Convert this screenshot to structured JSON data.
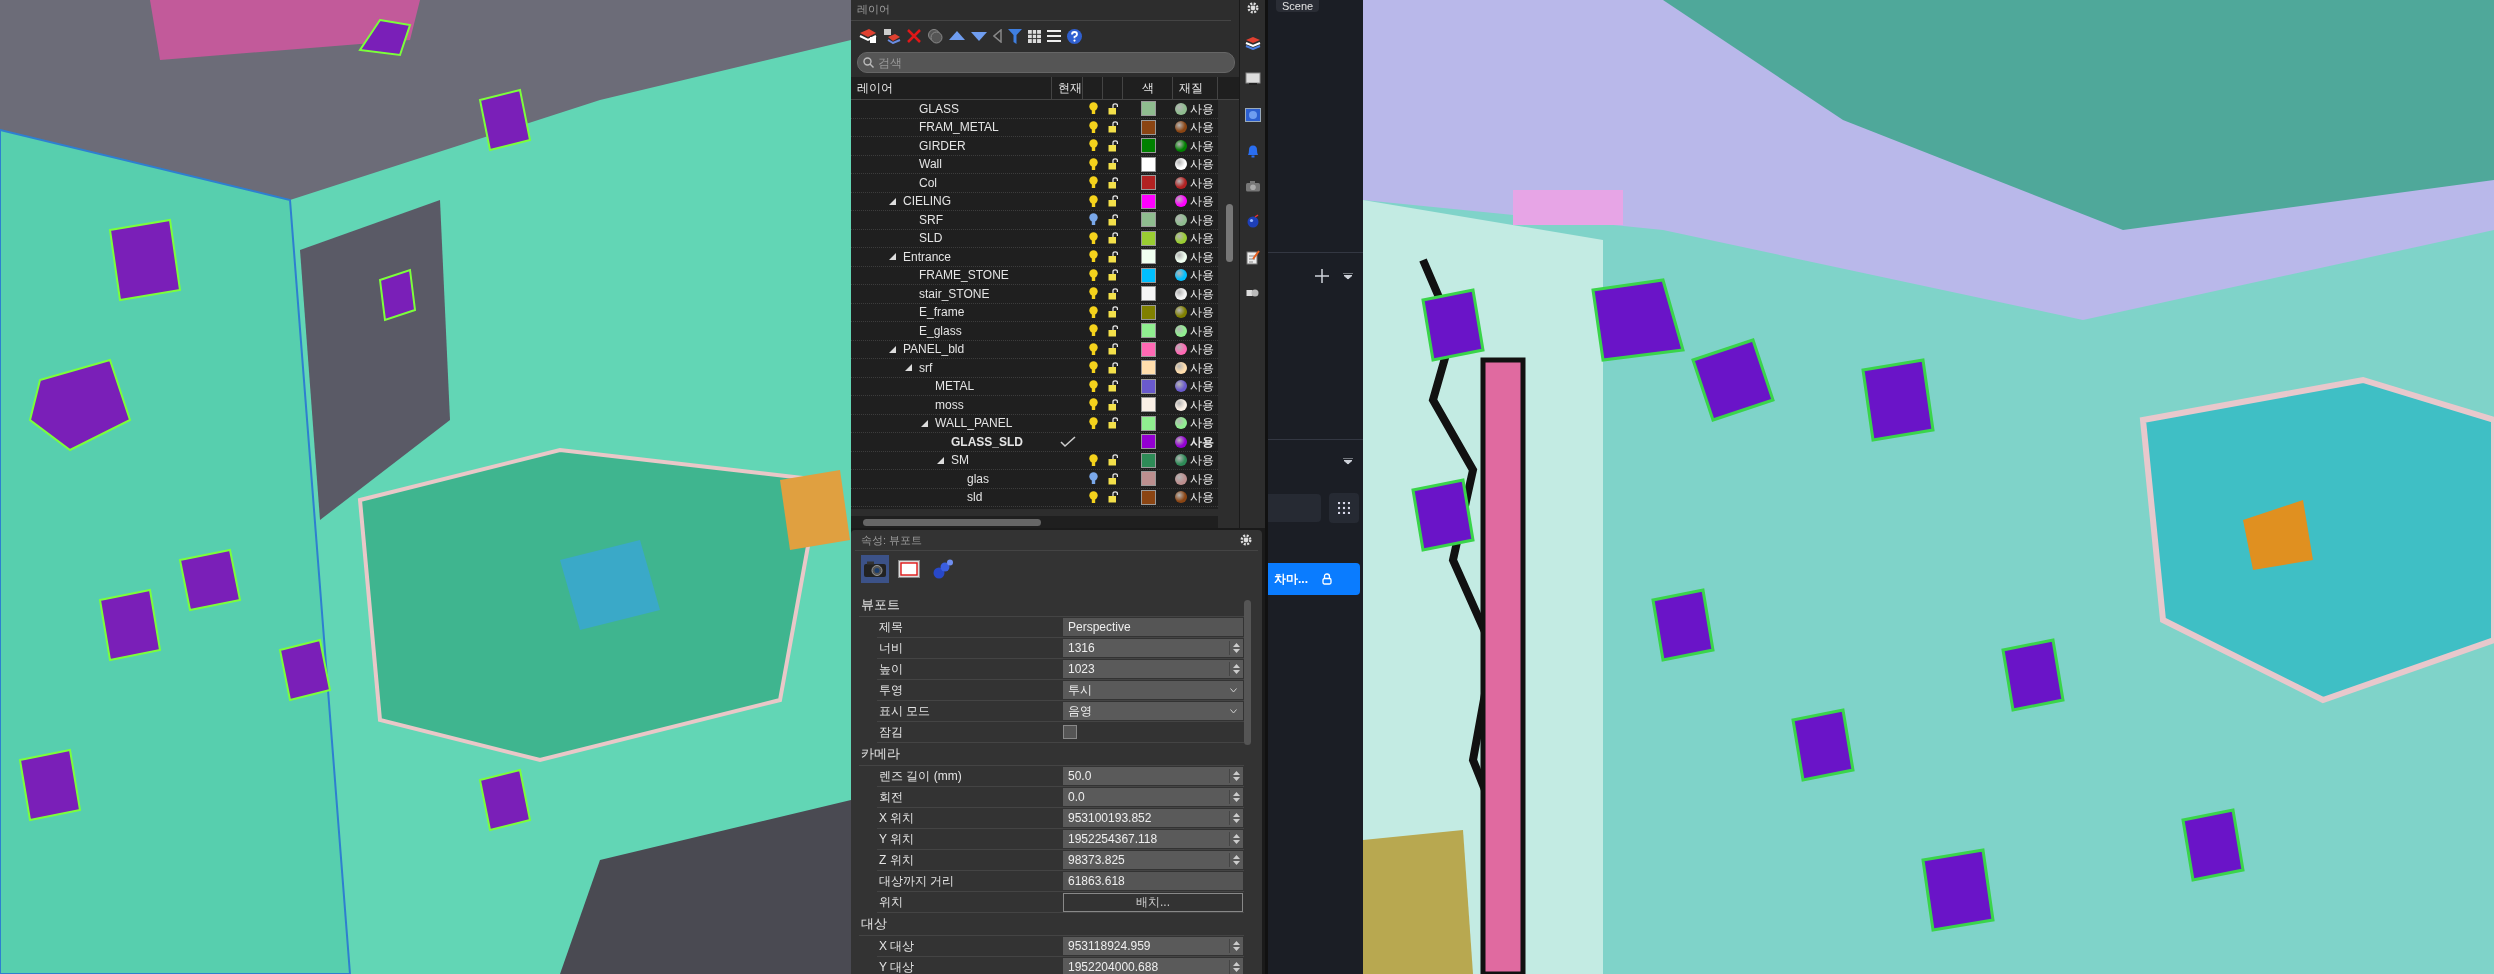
{
  "layers_panel": {
    "title": "레이어",
    "search": {
      "placeholder": "검색"
    },
    "columns": [
      "레이어",
      "현재",
      "색",
      "재질"
    ],
    "layers": [
      {
        "children": [
          {
            "name": "GLASS",
            "current": false,
            "on": true,
            "color": "#8fbc8f",
            "material": "사용"
          },
          {
            "name": "FRAM_METAL",
            "current": false,
            "on": true,
            "color": "#8b4513",
            "material": "사용"
          },
          {
            "name": "GIRDER",
            "current": false,
            "on": true,
            "color": "#008000",
            "material": "사용"
          },
          {
            "name": "Wall",
            "current": false,
            "on": true,
            "color": "#ffffff",
            "material": "사용"
          },
          {
            "name": "Col",
            "current": false,
            "on": true,
            "color": "#b22222",
            "material": "사용"
          }
        ]
      },
      {
        "name": "CIELING",
        "current": false,
        "expanded": true,
        "on": true,
        "color": "#ff00ff",
        "material": "사용",
        "children": [
          {
            "name": "SRF",
            "current": false,
            "on": false,
            "color": "#8fbc8f",
            "material": "사용"
          },
          {
            "name": "SLD",
            "current": false,
            "on": true,
            "color": "#9acd32",
            "material": "사용"
          }
        ]
      },
      {
        "name": "Entrance",
        "current": false,
        "expanded": true,
        "on": true,
        "color": "#f0fff0",
        "material": "사용",
        "children": [
          {
            "name": "FRAME_STONE",
            "current": false,
            "on": true,
            "color": "#00bfff",
            "material": "사용"
          },
          {
            "name": "stair_STONE",
            "current": false,
            "on": true,
            "color": "#f5f5f5",
            "material": "사용"
          },
          {
            "name": "E_frame",
            "current": false,
            "on": true,
            "color": "#808000",
            "material": "사용"
          },
          {
            "name": "E_glass",
            "current": false,
            "on": true,
            "color": "#90ee90",
            "material": "사용"
          }
        ]
      },
      {
        "name": "PANEL_bld",
        "current": false,
        "expanded": true,
        "on": true,
        "color": "#ff69b4",
        "material": "사용",
        "children": [
          {
            "name": "srf",
            "current": false,
            "expanded": true,
            "on": true,
            "color": "#ffdead",
            "material": "사용",
            "children": [
              {
                "name": "METAL",
                "current": false,
                "on": true,
                "color": "#6a5acd",
                "material": "사용"
              },
              {
                "name": "moss",
                "current": false,
                "on": true,
                "color": "#faf0e6",
                "material": "사용"
              },
              {
                "name": "WALL_PANEL",
                "current": false,
                "expanded": true,
                "on": true,
                "color": "#90ee90",
                "material": "사용",
                "children": [
                  {
                    "name": "GLASS_SLD",
                    "current": true,
                    "color": "#9400d3",
                    "material": "사용"
                  },
                  {
                    "name": "SM",
                    "current": false,
                    "expanded": true,
                    "on": true,
                    "color": "#2e8b57",
                    "material": "사용",
                    "children": [
                      {
                        "name": "glas",
                        "current": false,
                        "on": false,
                        "color": "#bc8f8f",
                        "material": "사용"
                      },
                      {
                        "name": "sld",
                        "current": false,
                        "on": true,
                        "color": "#8b4513",
                        "material": "사용"
                      }
                    ]
                  }
                ]
              }
            ]
          }
        ]
      }
    ]
  },
  "properties_panel": {
    "title": "속성: 뷰포트",
    "tabs": [
      {
        "selected": true
      },
      {
        "selected": false
      },
      {
        "selected": false
      }
    ],
    "sections": [
      {
        "title": "뷰포트",
        "rows": [
          {
            "label": "제목",
            "kind": "text",
            "value": "Perspective"
          },
          {
            "label": "너비",
            "kind": "spin",
            "value": "1316"
          },
          {
            "label": "높이",
            "kind": "spin",
            "value": "1023"
          },
          {
            "label": "투영",
            "kind": "select",
            "value": "투시"
          },
          {
            "label": "표시 모드",
            "kind": "select",
            "value": "음영"
          },
          {
            "label": "잠김",
            "kind": "checkbox",
            "checked": false
          }
        ]
      },
      {
        "title": "카메라",
        "rows": [
          {
            "label": "렌즈 길이 (mm)",
            "kind": "spin",
            "value": "50.0"
          },
          {
            "label": "회전",
            "kind": "spin",
            "value": "0.0"
          },
          {
            "label": "X 위치",
            "kind": "spin",
            "value": "953100193.852"
          },
          {
            "label": "Y 위치",
            "kind": "spin",
            "value": "1952254367.118"
          },
          {
            "label": "Z 위치",
            "kind": "spin",
            "value": "98373.825"
          },
          {
            "label": "대상까지 거리",
            "kind": "text",
            "value": "61863.618"
          },
          {
            "label": "위치",
            "kind": "button",
            "value": "배치..."
          }
        ]
      },
      {
        "title": "대상",
        "rows": [
          {
            "label": "X 대상",
            "kind": "spin",
            "value": "953118924.959"
          },
          {
            "label": "Y 대상",
            "kind": "spin",
            "value": "1952204000.688"
          }
        ]
      }
    ]
  },
  "side_panel": {
    "tab": "Scene",
    "button": "차마..."
  }
}
